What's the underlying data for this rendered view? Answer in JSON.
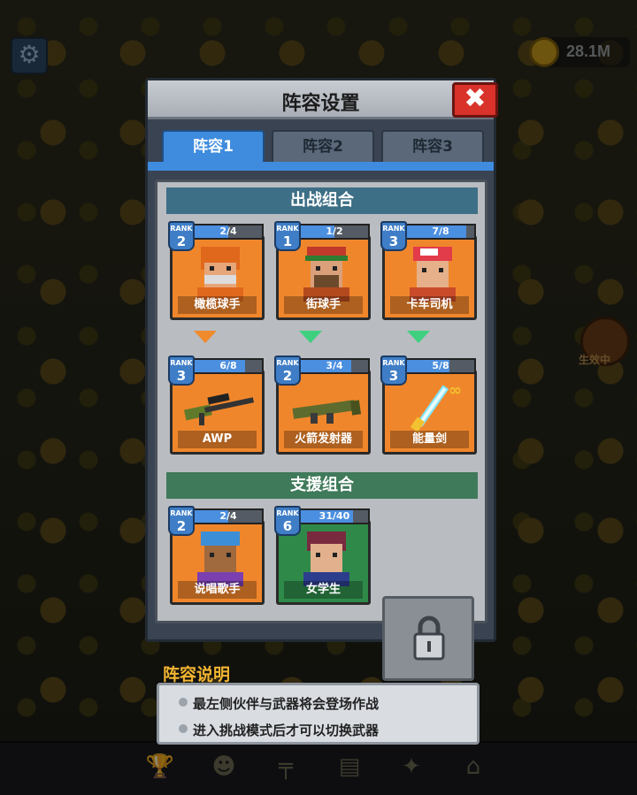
{
  "hud": {
    "coins": "28.1M",
    "side_label": "生效中"
  },
  "modal": {
    "title": "阵容设置",
    "tabs": [
      {
        "label": "阵容1",
        "active": true
      },
      {
        "label": "阵容2",
        "active": false
      },
      {
        "label": "阵容3",
        "active": false
      }
    ]
  },
  "battle": {
    "title": "出战组合",
    "characters": [
      {
        "name": "橄榄球手",
        "rank_word": "RANK",
        "rank": "2",
        "progress": "2/4",
        "progress_fraction": 0.5
      },
      {
        "name": "街球手",
        "rank_word": "RANK",
        "rank": "1",
        "progress": "1/2",
        "progress_fraction": 0.5
      },
      {
        "name": "卡车司机",
        "rank_word": "RANK",
        "rank": "3",
        "progress": "7/8",
        "progress_fraction": 0.875
      }
    ],
    "arrows": [
      "orange",
      "green",
      "green"
    ],
    "weapons": [
      {
        "name": "AWP",
        "rank_word": "RANK",
        "rank": "3",
        "progress": "6/8",
        "progress_fraction": 0.75
      },
      {
        "name": "火箭发射器",
        "rank_word": "RANK",
        "rank": "2",
        "progress": "3/4",
        "progress_fraction": 0.75
      },
      {
        "name": "能量剑",
        "rank_word": "RANK",
        "rank": "3",
        "progress": "5/8",
        "progress_fraction": 0.625
      }
    ]
  },
  "support": {
    "title": "支援组合",
    "characters": [
      {
        "name": "说唱歌手",
        "rank_word": "RANK",
        "rank": "2",
        "progress": "2/4",
        "progress_fraction": 0.5
      },
      {
        "name": "女学生",
        "rank_word": "RANK",
        "rank": "6",
        "progress": "31/40",
        "progress_fraction": 0.775
      }
    ]
  },
  "explanation": {
    "title": "阵容说明",
    "lines": [
      "最左侧伙伴与武器将会登场作战",
      "进入挑战模式后才可以切换武器"
    ]
  },
  "colors": {
    "tab_active": "#3f8cde",
    "card_orange": "#f0862b",
    "card_green": "#2f8a4a",
    "progress_fill": "#4b8fe0",
    "close_red": "#d9322a"
  }
}
